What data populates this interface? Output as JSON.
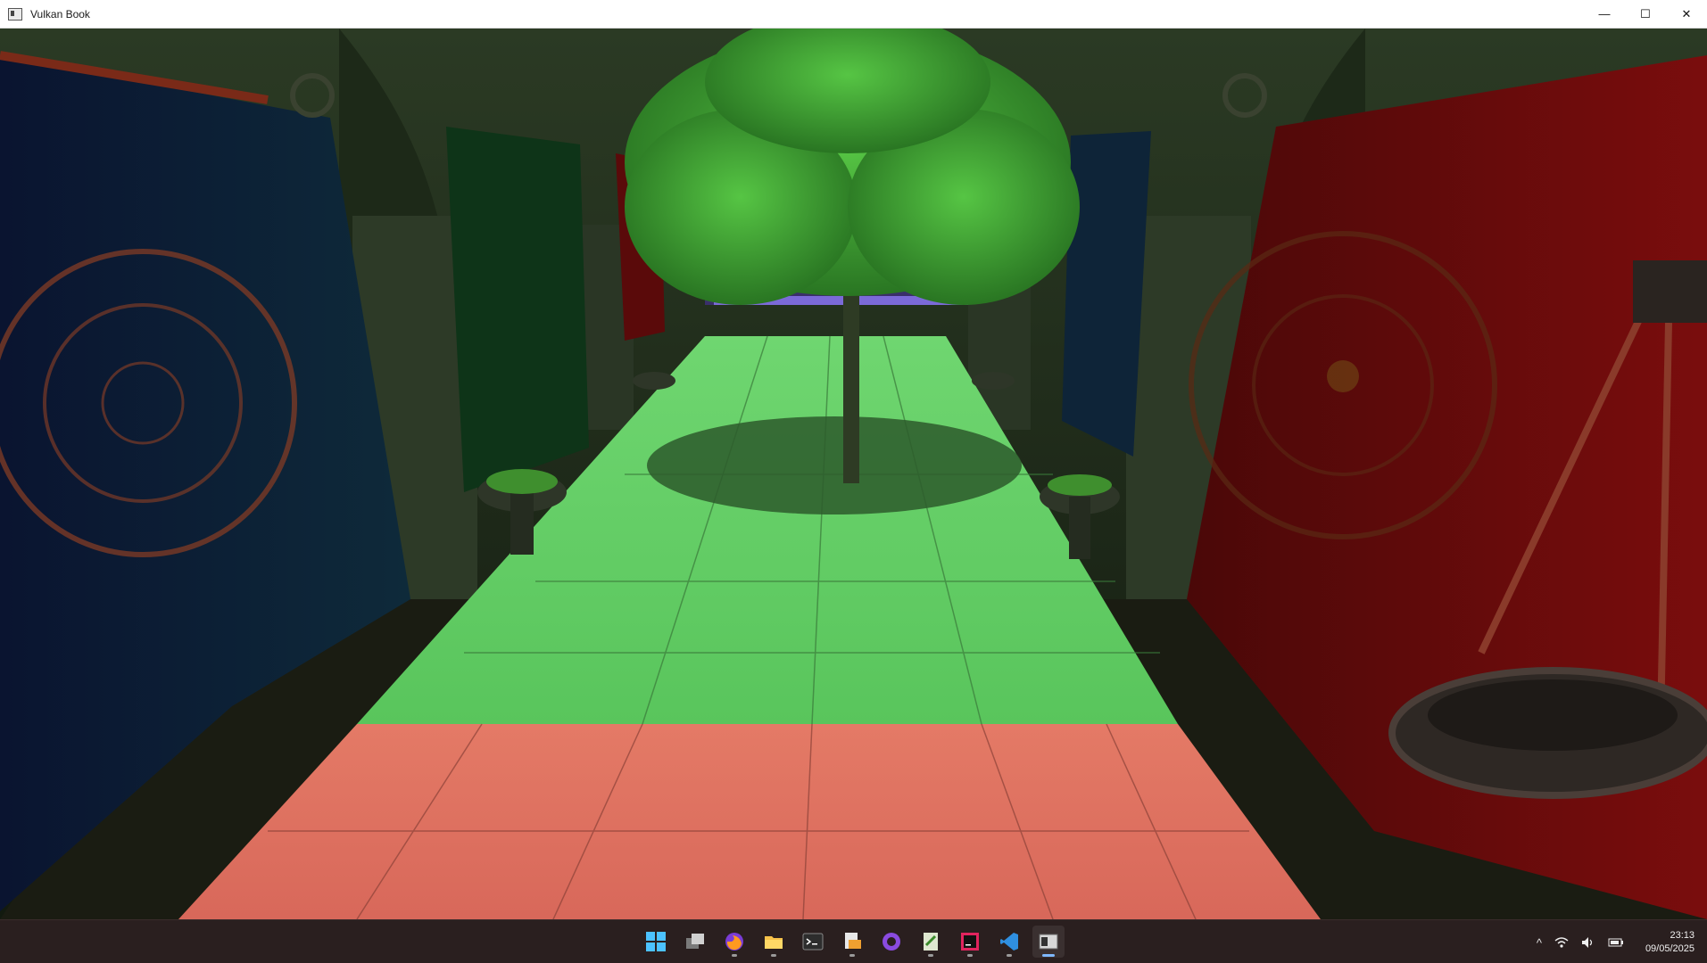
{
  "window": {
    "title": "Vulkan Book",
    "icon": "app-window-icon",
    "controls": {
      "minimize": "—",
      "maximize": "☐",
      "close": "✕"
    }
  },
  "scene": {
    "description_icon": "3d-render-viewport",
    "palette": {
      "floor_green": "#64d368",
      "floor_red": "#e27060",
      "curtain_blue": "#0f1c3a",
      "curtain_red": "#6a0c0c",
      "tree_leaves": "#3ea631",
      "wall": "#26331f"
    }
  },
  "taskbar": {
    "apps": [
      {
        "name": "start",
        "icon": "windows-start-icon",
        "active": false
      },
      {
        "name": "task-view",
        "icon": "task-view-icon",
        "active": false
      },
      {
        "name": "firefox",
        "icon": "firefox-icon",
        "active": false
      },
      {
        "name": "file-explorer",
        "icon": "folder-icon",
        "active": false
      },
      {
        "name": "terminal",
        "icon": "terminal-icon",
        "active": false
      },
      {
        "name": "files-app",
        "icon": "file-manager-icon",
        "active": false
      },
      {
        "name": "github-desktop",
        "icon": "github-icon",
        "active": false
      },
      {
        "name": "script-editor",
        "icon": "editor-icon",
        "active": false
      },
      {
        "name": "intellij",
        "icon": "jetbrains-icon",
        "active": false
      },
      {
        "name": "vscode",
        "icon": "vscode-icon",
        "active": false
      },
      {
        "name": "vulkan-book",
        "icon": "app-window-icon",
        "active": true
      }
    ],
    "tray": {
      "chevron": "^",
      "wifi": "wifi-icon",
      "volume": "volume-icon",
      "battery": "battery-icon"
    },
    "clock": {
      "time": "23:13",
      "date": "09/05/2025"
    }
  }
}
